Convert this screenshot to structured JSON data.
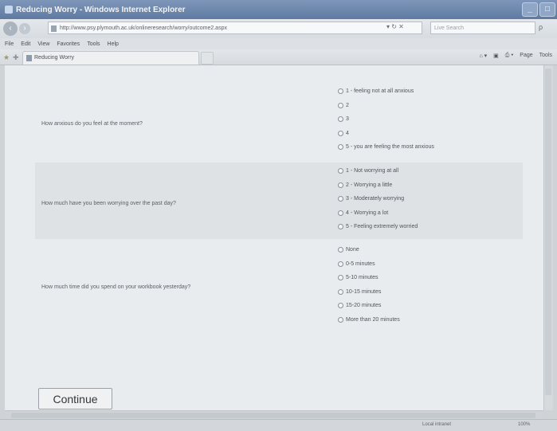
{
  "window": {
    "title": "Reducing Worry - Windows Internet Explorer",
    "controls": [
      "_",
      "□"
    ]
  },
  "addressbar": {
    "back": "‹",
    "forward": "›",
    "url": "http://www.psy.plymouth.ac.uk/onlineresearch/worry/outcome2.aspx",
    "refresh_stop": "▾ ↻ ✕",
    "search_placeholder": "Live Search",
    "search_go": "ρ"
  },
  "menu": [
    "File",
    "Edit",
    "View",
    "Favorites",
    "Tools",
    "Help"
  ],
  "tabs": [
    {
      "label": "Reducing Worry"
    }
  ],
  "commandbar": [
    "Page",
    "Tools"
  ],
  "questions": [
    {
      "text": "How anxious do you feel at the moment?",
      "options": [
        "1 - feeling not at all anxious",
        "2",
        "3",
        "4",
        "5 - you are feeling the most anxious"
      ]
    },
    {
      "text": "How much have you been worrying over the past day?",
      "options": [
        "1 - Not worrying at all",
        "2 - Worrying a little",
        "3 - Moderately worrying",
        "4 - Worrying a lot",
        "5 - Feeling extremely worried"
      ]
    },
    {
      "text": "How much time did you spend on your workbook yesterday?",
      "options": [
        "None",
        "0-5 minutes",
        "5-10 minutes",
        "10-15 minutes",
        "15-20 minutes",
        "More than 20 minutes"
      ]
    }
  ],
  "continue_label": "Continue",
  "status": {
    "zone": "Local intranet",
    "zoom": "100%"
  }
}
